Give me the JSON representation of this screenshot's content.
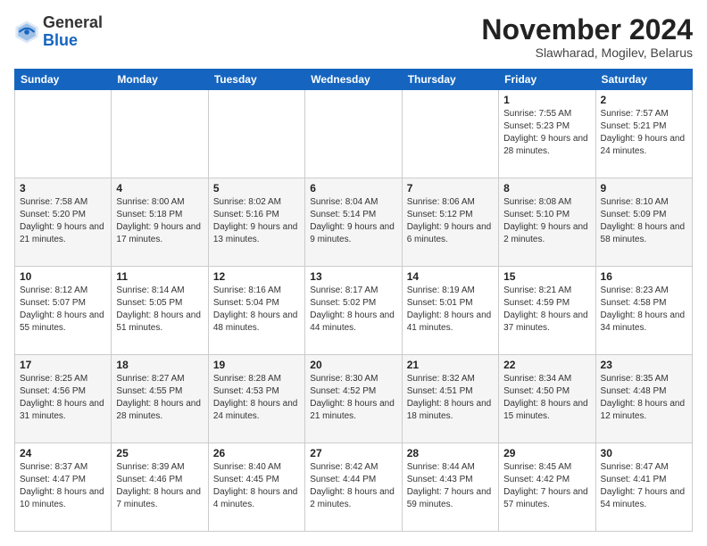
{
  "header": {
    "logo_general": "General",
    "logo_blue": "Blue",
    "month_title": "November 2024",
    "subtitle": "Slawharad, Mogilev, Belarus"
  },
  "weekdays": [
    "Sunday",
    "Monday",
    "Tuesday",
    "Wednesday",
    "Thursday",
    "Friday",
    "Saturday"
  ],
  "weeks": [
    [
      {
        "day": "",
        "sunrise": "",
        "sunset": "",
        "daylight": ""
      },
      {
        "day": "",
        "sunrise": "",
        "sunset": "",
        "daylight": ""
      },
      {
        "day": "",
        "sunrise": "",
        "sunset": "",
        "daylight": ""
      },
      {
        "day": "",
        "sunrise": "",
        "sunset": "",
        "daylight": ""
      },
      {
        "day": "",
        "sunrise": "",
        "sunset": "",
        "daylight": ""
      },
      {
        "day": "1",
        "sunrise": "Sunrise: 7:55 AM",
        "sunset": "Sunset: 5:23 PM",
        "daylight": "Daylight: 9 hours and 28 minutes."
      },
      {
        "day": "2",
        "sunrise": "Sunrise: 7:57 AM",
        "sunset": "Sunset: 5:21 PM",
        "daylight": "Daylight: 9 hours and 24 minutes."
      }
    ],
    [
      {
        "day": "3",
        "sunrise": "Sunrise: 7:58 AM",
        "sunset": "Sunset: 5:20 PM",
        "daylight": "Daylight: 9 hours and 21 minutes."
      },
      {
        "day": "4",
        "sunrise": "Sunrise: 8:00 AM",
        "sunset": "Sunset: 5:18 PM",
        "daylight": "Daylight: 9 hours and 17 minutes."
      },
      {
        "day": "5",
        "sunrise": "Sunrise: 8:02 AM",
        "sunset": "Sunset: 5:16 PM",
        "daylight": "Daylight: 9 hours and 13 minutes."
      },
      {
        "day": "6",
        "sunrise": "Sunrise: 8:04 AM",
        "sunset": "Sunset: 5:14 PM",
        "daylight": "Daylight: 9 hours and 9 minutes."
      },
      {
        "day": "7",
        "sunrise": "Sunrise: 8:06 AM",
        "sunset": "Sunset: 5:12 PM",
        "daylight": "Daylight: 9 hours and 6 minutes."
      },
      {
        "day": "8",
        "sunrise": "Sunrise: 8:08 AM",
        "sunset": "Sunset: 5:10 PM",
        "daylight": "Daylight: 9 hours and 2 minutes."
      },
      {
        "day": "9",
        "sunrise": "Sunrise: 8:10 AM",
        "sunset": "Sunset: 5:09 PM",
        "daylight": "Daylight: 8 hours and 58 minutes."
      }
    ],
    [
      {
        "day": "10",
        "sunrise": "Sunrise: 8:12 AM",
        "sunset": "Sunset: 5:07 PM",
        "daylight": "Daylight: 8 hours and 55 minutes."
      },
      {
        "day": "11",
        "sunrise": "Sunrise: 8:14 AM",
        "sunset": "Sunset: 5:05 PM",
        "daylight": "Daylight: 8 hours and 51 minutes."
      },
      {
        "day": "12",
        "sunrise": "Sunrise: 8:16 AM",
        "sunset": "Sunset: 5:04 PM",
        "daylight": "Daylight: 8 hours and 48 minutes."
      },
      {
        "day": "13",
        "sunrise": "Sunrise: 8:17 AM",
        "sunset": "Sunset: 5:02 PM",
        "daylight": "Daylight: 8 hours and 44 minutes."
      },
      {
        "day": "14",
        "sunrise": "Sunrise: 8:19 AM",
        "sunset": "Sunset: 5:01 PM",
        "daylight": "Daylight: 8 hours and 41 minutes."
      },
      {
        "day": "15",
        "sunrise": "Sunrise: 8:21 AM",
        "sunset": "Sunset: 4:59 PM",
        "daylight": "Daylight: 8 hours and 37 minutes."
      },
      {
        "day": "16",
        "sunrise": "Sunrise: 8:23 AM",
        "sunset": "Sunset: 4:58 PM",
        "daylight": "Daylight: 8 hours and 34 minutes."
      }
    ],
    [
      {
        "day": "17",
        "sunrise": "Sunrise: 8:25 AM",
        "sunset": "Sunset: 4:56 PM",
        "daylight": "Daylight: 8 hours and 31 minutes."
      },
      {
        "day": "18",
        "sunrise": "Sunrise: 8:27 AM",
        "sunset": "Sunset: 4:55 PM",
        "daylight": "Daylight: 8 hours and 28 minutes."
      },
      {
        "day": "19",
        "sunrise": "Sunrise: 8:28 AM",
        "sunset": "Sunset: 4:53 PM",
        "daylight": "Daylight: 8 hours and 24 minutes."
      },
      {
        "day": "20",
        "sunrise": "Sunrise: 8:30 AM",
        "sunset": "Sunset: 4:52 PM",
        "daylight": "Daylight: 8 hours and 21 minutes."
      },
      {
        "day": "21",
        "sunrise": "Sunrise: 8:32 AM",
        "sunset": "Sunset: 4:51 PM",
        "daylight": "Daylight: 8 hours and 18 minutes."
      },
      {
        "day": "22",
        "sunrise": "Sunrise: 8:34 AM",
        "sunset": "Sunset: 4:50 PM",
        "daylight": "Daylight: 8 hours and 15 minutes."
      },
      {
        "day": "23",
        "sunrise": "Sunrise: 8:35 AM",
        "sunset": "Sunset: 4:48 PM",
        "daylight": "Daylight: 8 hours and 12 minutes."
      }
    ],
    [
      {
        "day": "24",
        "sunrise": "Sunrise: 8:37 AM",
        "sunset": "Sunset: 4:47 PM",
        "daylight": "Daylight: 8 hours and 10 minutes."
      },
      {
        "day": "25",
        "sunrise": "Sunrise: 8:39 AM",
        "sunset": "Sunset: 4:46 PM",
        "daylight": "Daylight: 8 hours and 7 minutes."
      },
      {
        "day": "26",
        "sunrise": "Sunrise: 8:40 AM",
        "sunset": "Sunset: 4:45 PM",
        "daylight": "Daylight: 8 hours and 4 minutes."
      },
      {
        "day": "27",
        "sunrise": "Sunrise: 8:42 AM",
        "sunset": "Sunset: 4:44 PM",
        "daylight": "Daylight: 8 hours and 2 minutes."
      },
      {
        "day": "28",
        "sunrise": "Sunrise: 8:44 AM",
        "sunset": "Sunset: 4:43 PM",
        "daylight": "Daylight: 7 hours and 59 minutes."
      },
      {
        "day": "29",
        "sunrise": "Sunrise: 8:45 AM",
        "sunset": "Sunset: 4:42 PM",
        "daylight": "Daylight: 7 hours and 57 minutes."
      },
      {
        "day": "30",
        "sunrise": "Sunrise: 8:47 AM",
        "sunset": "Sunset: 4:41 PM",
        "daylight": "Daylight: 7 hours and 54 minutes."
      }
    ]
  ]
}
